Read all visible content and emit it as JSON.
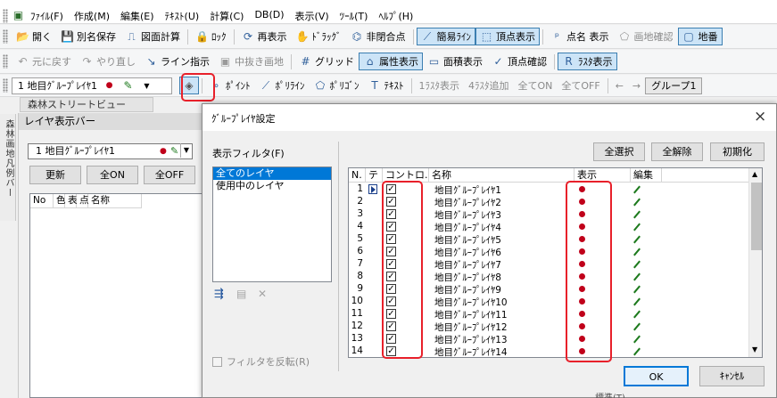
{
  "menubar": [
    "ﾌｧｲﾙ(F)",
    "作成(M)",
    "編集(E)",
    "ﾃｷｽﾄ(U)",
    "計算(C)",
    "DB(D)",
    "表示(V)",
    "ﾂｰﾙ(T)",
    "ﾍﾙﾌﾟ(H)"
  ],
  "toolbar1": [
    {
      "label": "開く",
      "icon": "folder-icon",
      "glyph": "📂",
      "active": false,
      "dim": false
    },
    {
      "label": "別名保存",
      "icon": "save-icon",
      "glyph": "💾",
      "active": false,
      "dim": false
    },
    {
      "label": "図面計算",
      "icon": "calc-icon",
      "glyph": "⎍",
      "active": false,
      "dim": false
    },
    {
      "label": "ﾛｯｸ",
      "icon": "lock-icon",
      "glyph": "🔒",
      "active": false,
      "dim": false
    },
    {
      "label": "再表示",
      "icon": "refresh-icon",
      "glyph": "⟳",
      "active": false,
      "dim": false
    },
    {
      "label": "ﾄﾞﾗｯｸﾞ",
      "icon": "hand-icon",
      "glyph": "✋",
      "active": false,
      "dim": false
    },
    {
      "label": "非閉合点",
      "icon": "open-point-icon",
      "glyph": "⌬",
      "active": false,
      "dim": false
    },
    {
      "label": "簡易ﾗｲﾝ",
      "icon": "simple-line-icon",
      "glyph": "⟋",
      "active": true,
      "dim": false
    },
    {
      "label": "頂点表示",
      "icon": "vertex-icon",
      "glyph": "⬚",
      "active": true,
      "dim": false
    },
    {
      "label": "点名 表示",
      "icon": "point-name-icon",
      "glyph": "ᵖ",
      "active": false,
      "dim": false
    },
    {
      "label": "画地確認",
      "icon": "lot-check-icon",
      "glyph": "⬠",
      "active": false,
      "dim": true
    },
    {
      "label": "地番",
      "icon": "lot-number-icon",
      "glyph": "▢",
      "active": true,
      "dim": false
    }
  ],
  "toolbar2": [
    {
      "label": "元に戻す",
      "icon": "undo-icon",
      "glyph": "↶",
      "active": false,
      "dim": true
    },
    {
      "label": "やり直し",
      "icon": "redo-icon",
      "glyph": "↷",
      "active": false,
      "dim": true
    },
    {
      "label": "ライン指示",
      "icon": "line-pick-icon",
      "glyph": "↘",
      "active": false,
      "dim": false
    },
    {
      "label": "中抜き画地",
      "icon": "hollow-lot-icon",
      "glyph": "▣",
      "active": false,
      "dim": true
    },
    {
      "label": "グリッド",
      "icon": "grid-icon",
      "glyph": "#",
      "active": false,
      "dim": false
    },
    {
      "label": "属性表示",
      "icon": "attribute-icon",
      "glyph": "⌂",
      "active": true,
      "dim": false
    },
    {
      "label": "面積表示",
      "icon": "area-icon",
      "glyph": "▭",
      "active": false,
      "dim": false
    },
    {
      "label": "頂点確認",
      "icon": "vertex-check-icon",
      "glyph": "✓",
      "active": false,
      "dim": false
    },
    {
      "label": "ﾗｽﾀ表示",
      "icon": "raster-icon",
      "glyph": "R",
      "active": true,
      "dim": false
    }
  ],
  "toolbar3": {
    "layer_select": "1  地目ｸﾞﾙｰﾌﾟﾚｲﾔ1",
    "tools": [
      {
        "label": "ﾎﾟｲﾝﾄ",
        "icon": "point-icon",
        "glyph": "∘",
        "dim": false
      },
      {
        "label": "ﾎﾟﾘﾗｲﾝ",
        "icon": "polyline-icon",
        "glyph": "⟋",
        "dim": false
      },
      {
        "label": "ﾎﾟﾘｺﾞﾝ",
        "icon": "polygon-icon",
        "glyph": "⬠",
        "dim": false
      },
      {
        "label": "ﾃｷｽﾄ",
        "icon": "text-icon",
        "glyph": "T",
        "dim": false
      },
      {
        "label": "1ﾗｽﾀ表示",
        "icon": "",
        "glyph": "",
        "dim": true
      },
      {
        "label": "4ﾗｽﾀ追加",
        "icon": "",
        "glyph": "",
        "dim": true
      },
      {
        "label": "全てON",
        "icon": "",
        "glyph": "",
        "dim": true
      },
      {
        "label": "全てOFF",
        "icon": "",
        "glyph": "",
        "dim": true
      }
    ],
    "group_select": "グループ1"
  },
  "street_tab": "森林ストリートビュー",
  "vertical_tab": "森林画地凡例バー",
  "layer_panel": {
    "title": "レイヤ表示バー",
    "layer_combo": "1  地目ｸﾞﾙｰﾌﾟﾚｲﾔ1",
    "btn_update": "更新",
    "btn_all_on": "全ON",
    "btn_all_off": "全OFF",
    "columns": [
      "No",
      "色",
      "表",
      "点",
      "名称"
    ]
  },
  "dialog": {
    "title": "ｸﾞﾙｰﾌﾟﾚｲﾔ設定",
    "filter_label": "表示フィルタ(F)",
    "filter_options": [
      "全てのレイヤ",
      "使用中のレイヤ"
    ],
    "filter_selected": 0,
    "invert_label": "フィルタを反転(R)",
    "btn_select_all": "全選択",
    "btn_clear_all": "全解除",
    "btn_init": "初期化",
    "btn_ok": "OK",
    "btn_cancel": "ｷｬﾝｾﾙ",
    "columns": {
      "no": "N.",
      "t": "テ",
      "control": "コントロ...",
      "name": "名称",
      "display": "表示",
      "edit": "編集"
    },
    "rows": [
      {
        "no": "1",
        "name": "地目ｸﾞﾙｰﾌﾟﾚｲﾔ1",
        "current": true
      },
      {
        "no": "2",
        "name": "地目ｸﾞﾙｰﾌﾟﾚｲﾔ2"
      },
      {
        "no": "3",
        "name": "地目ｸﾞﾙｰﾌﾟﾚｲﾔ3"
      },
      {
        "no": "4",
        "name": "地目ｸﾞﾙｰﾌﾟﾚｲﾔ4"
      },
      {
        "no": "5",
        "name": "地目ｸﾞﾙｰﾌﾟﾚｲﾔ5"
      },
      {
        "no": "6",
        "name": "地目ｸﾞﾙｰﾌﾟﾚｲﾔ6"
      },
      {
        "no": "7",
        "name": "地目ｸﾞﾙｰﾌﾟﾚｲﾔ7"
      },
      {
        "no": "8",
        "name": "地目ｸﾞﾙｰﾌﾟﾚｲﾔ8"
      },
      {
        "no": "9",
        "name": "地目ｸﾞﾙｰﾌﾟﾚｲﾔ9"
      },
      {
        "no": "10",
        "name": "地目ｸﾞﾙｰﾌﾟﾚｲﾔ10"
      },
      {
        "no": "11",
        "name": "地目ｸﾞﾙｰﾌﾟﾚｲﾔ11"
      },
      {
        "no": "12",
        "name": "地目ｸﾞﾙｰﾌﾟﾚｲﾔ12"
      },
      {
        "no": "13",
        "name": "地目ｸﾞﾙｰﾌﾟﾚｲﾔ13"
      },
      {
        "no": "14",
        "name": "地目ｸﾞﾙｰﾌﾟﾚｲﾔ14"
      }
    ],
    "bg_text": "標準(T)"
  },
  "colors": {
    "highlight": "#e8202a",
    "active_bg": "#cce4f7",
    "active_border": "#3c7fb1",
    "selection": "#0078d7",
    "display_dot": "#c0001a",
    "edit_pen": "#1d7a1d"
  }
}
